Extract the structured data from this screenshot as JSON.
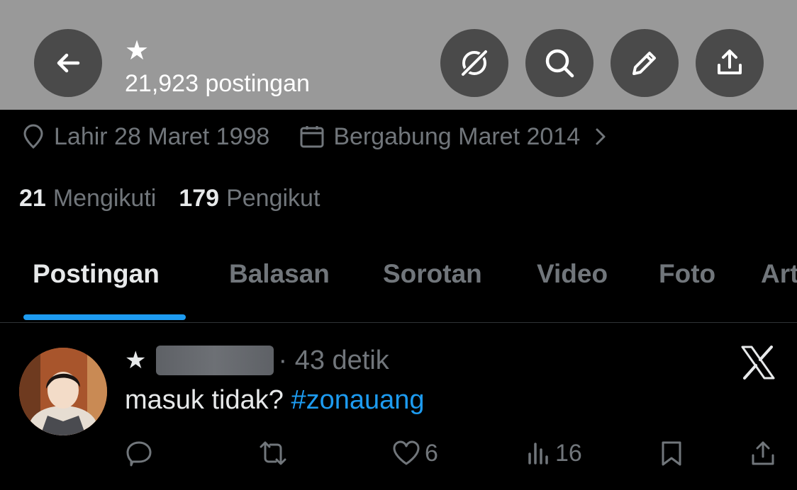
{
  "header": {
    "name": "★",
    "post_count": "21,923 postingan"
  },
  "meta": {
    "birth": "Lahir 28 Maret 1998",
    "joined": "Bergabung Maret 2014"
  },
  "follow": {
    "following_count": "21",
    "following_label": "Mengikuti",
    "followers_count": "179",
    "followers_label": "Pengikut"
  },
  "tabs": [
    {
      "label": "Postingan",
      "active": true
    },
    {
      "label": "Balasan"
    },
    {
      "label": "Sorotan"
    },
    {
      "label": "Video"
    },
    {
      "label": "Foto"
    },
    {
      "label": "Artikel"
    }
  ],
  "post": {
    "name_star": "★",
    "time": "· 43 detik",
    "text": "masuk tidak?",
    "hashtag": "#zonauang",
    "likes": "6",
    "views": "16"
  },
  "colors": {
    "accent": "#1d9bf0",
    "header_bg": "#999999",
    "button_bg": "#4a4a4a",
    "muted": "#71767b"
  },
  "icons": [
    "back-arrow-icon",
    "grok-icon",
    "search-icon",
    "edit-pencil-icon",
    "share-upload-icon",
    "location-icon",
    "calendar-icon",
    "chevron-right-icon",
    "x-logo-icon",
    "reply-icon",
    "repost-icon",
    "like-icon",
    "views-icon",
    "bookmark-icon",
    "share-icon"
  ]
}
